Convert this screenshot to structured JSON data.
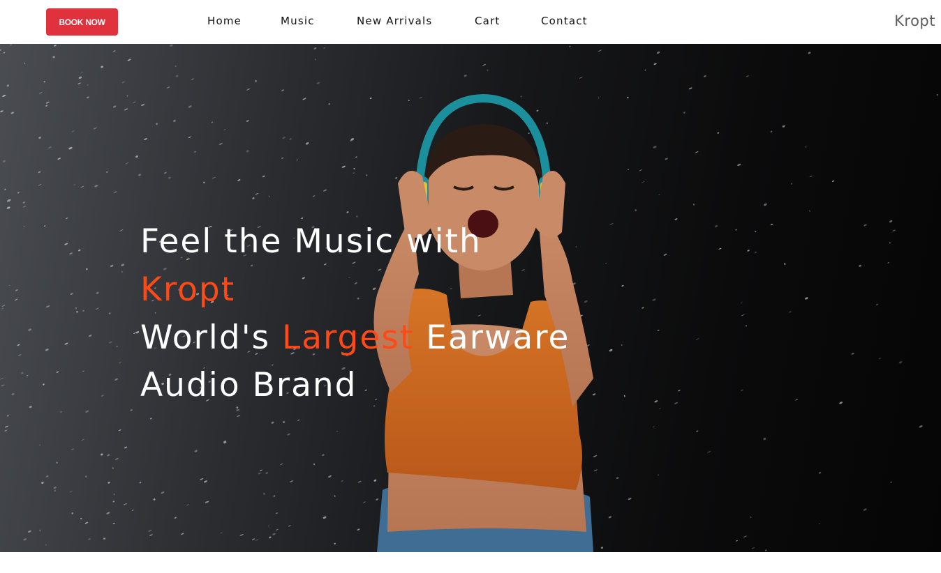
{
  "header": {
    "book_button": "BOOK NOW",
    "brand": "Kropt",
    "nav": [
      "Home",
      "Music",
      "New Arrivals",
      "Cart",
      "Contact"
    ]
  },
  "hero": {
    "line1": "Feel the Music with",
    "line2": "Kropt",
    "line3_before": "World's ",
    "line3_accent": "Largest",
    "line3_after": " Earware",
    "line4": "Audio Brand"
  },
  "colors": {
    "accent": "#ff4a17",
    "button": "#e0323d"
  }
}
